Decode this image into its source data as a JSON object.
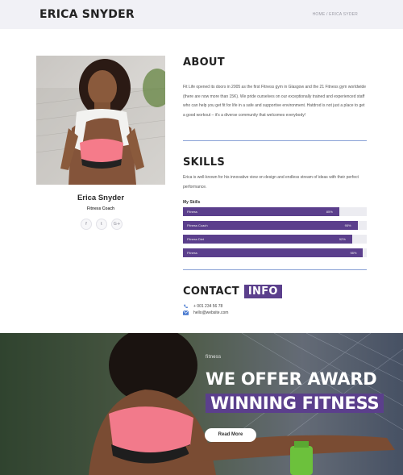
{
  "header": {
    "brand": "ERICA SNYDER",
    "breadcrumb": "HOME / ERICA SYDER"
  },
  "profile": {
    "name": "Erica Snyder",
    "role": "Fitness Coach",
    "socials": [
      {
        "icon": "facebook-icon",
        "glyph": "f"
      },
      {
        "icon": "twitter-icon",
        "glyph": "t"
      },
      {
        "icon": "google-plus-icon",
        "glyph": "G+"
      }
    ]
  },
  "about": {
    "title": "ABOUT",
    "text": "Fit Life opened its doors in 2005 as the first Fitness gym in Glasgow and the 21 Fitness gym worldwide (there are now more than 15K). We pride ourselves on our exceptionally trained and experienced staff who can help you get fit for life in a safe and supportive environment. Hatdrod is not just a place to get a good workout – it's a diverse community that welcomes everybody!"
  },
  "skills": {
    "title": "SKILLS",
    "text": "Erica is well-known for his innovative view on design and endless stream of ideas with their perfect performance.",
    "subtitle": "My Skills",
    "items": [
      {
        "label": "Fitness",
        "percent": 85,
        "percent_label": "85%"
      },
      {
        "label": "Fitness Coach",
        "percent": 95,
        "percent_label": "95%"
      },
      {
        "label": "Fitness Diet",
        "percent": 92,
        "percent_label": "92%"
      },
      {
        "label": "Fitness",
        "percent": 98,
        "percent_label": "98%"
      }
    ]
  },
  "contact": {
    "title": "CONTACT",
    "tag": "INFO",
    "phone": "+ 001 234 56 78",
    "email": "hello@website.com"
  },
  "hero": {
    "small": "fitness",
    "line1": "WE OFFER AWARD",
    "line2": "WINNING FITNESS",
    "button": "Read More"
  },
  "colors": {
    "accent": "#5b3f8c",
    "rule": "#8aa2d6",
    "header_bg": "#f1f1f6"
  }
}
